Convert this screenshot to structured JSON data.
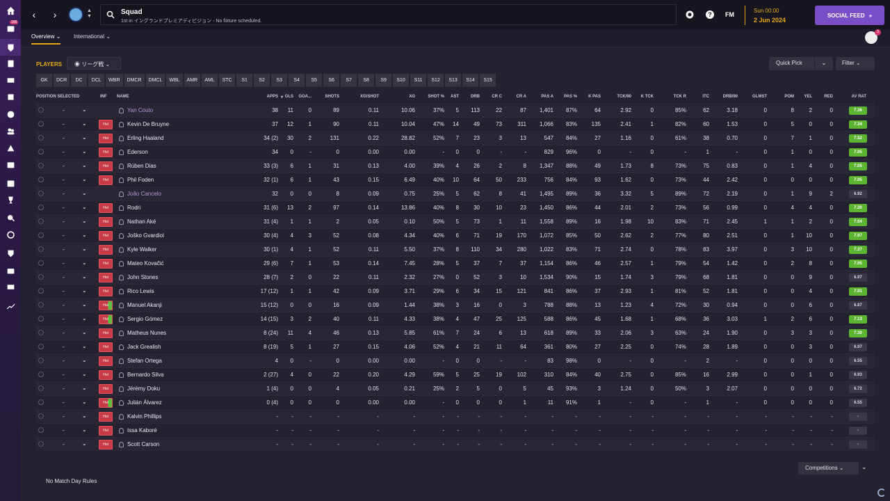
{
  "topbar": {
    "title": "Squad",
    "subtitle": "1st in イングランドプレミアディビジョン - No fixture scheduled.",
    "fm_logo": "FM",
    "date_time": "Sun 00:00",
    "date_day": "2 Jun 2024",
    "social_feed": "SOCIAL FEED",
    "rail_badge": "160",
    "avatar_badge": "3"
  },
  "subnav": {
    "tabs": [
      "Overview",
      "International"
    ]
  },
  "controls": {
    "players_label": "PLAYERS",
    "league_select": "リーグ戦",
    "quick_pick": "Quick Pick",
    "filter": "Filter",
    "competitions": "Competitions",
    "rules": "No Match Day Rules"
  },
  "positions": [
    "GK",
    "DCR",
    "DC",
    "DCL",
    "WBR",
    "DMCR",
    "DMCL",
    "WBL",
    "AMR",
    "AML",
    "STC",
    "S1",
    "S2",
    "S3",
    "S4",
    "S5",
    "S6",
    "S7",
    "S8",
    "S9",
    "S10",
    "S11",
    "S12",
    "S13",
    "S14",
    "S15"
  ],
  "columns": [
    "POSITION SELECTED",
    "INF",
    "NAME",
    "APPS",
    "GLS",
    "GOA...",
    "SHOTS",
    "XG/SHOT",
    "XG",
    "SHOT %",
    "AST",
    "DRB",
    "CR C",
    "CR A",
    "PAS A",
    "PAS %",
    "K PAS",
    "TCK/90",
    "K TCK",
    "TCK R",
    "ITC",
    "DRB/90",
    "GLMST",
    "POM",
    "YEL",
    "RED",
    "AV RAT"
  ],
  "players": [
    {
      "pos": "-",
      "inf": "",
      "name": "Yan Couto",
      "loan": true,
      "stats": [
        "38",
        "11",
        "0",
        "89",
        "0.11",
        "10.06",
        "37%",
        "5",
        "113",
        "22",
        "87",
        "1,401",
        "87%",
        "64",
        "2.92",
        "0",
        "85%",
        "62",
        "3.18",
        "0",
        "8",
        "2",
        "0"
      ],
      "rating": "7.36",
      "rc": "green"
    },
    {
      "pos": "-",
      "inf": "Hol",
      "name": "Kevin De Bruyne",
      "stats": [
        "37",
        "12",
        "1",
        "90",
        "0.11",
        "10.04",
        "47%",
        "14",
        "49",
        "73",
        "311",
        "1,066",
        "83%",
        "135",
        "2.41",
        "1",
        "82%",
        "60",
        "1.53",
        "0",
        "5",
        "0",
        "0"
      ],
      "rating": "7.34",
      "rc": "green"
    },
    {
      "pos": "-",
      "inf": "Hol",
      "name": "Erling Haaland",
      "stats": [
        "34 (2)",
        "30",
        "2",
        "131",
        "0.22",
        "28.82",
        "52%",
        "7",
        "23",
        "3",
        "13",
        "547",
        "84%",
        "27",
        "1.16",
        "0",
        "61%",
        "38",
        "0.70",
        "0",
        "7",
        "1",
        "0"
      ],
      "rating": "7.52",
      "rc": "green"
    },
    {
      "pos": "-",
      "inf": "Hol",
      "name": "Ederson",
      "stats": [
        "34",
        "0",
        "-",
        "0",
        "0.00",
        "0.00",
        "-",
        "0",
        "0",
        "-",
        "-",
        "829",
        "96%",
        "0",
        "-",
        "0",
        "-",
        "1",
        "-",
        "0",
        "1",
        "0",
        "0"
      ],
      "rating": "7.05",
      "rc": "green"
    },
    {
      "pos": "-",
      "inf": "Hol",
      "name": "Rúben Dias",
      "stats": [
        "33 (3)",
        "6",
        "1",
        "31",
        "0.13",
        "4.00",
        "39%",
        "4",
        "26",
        "2",
        "8",
        "1,347",
        "88%",
        "49",
        "1.73",
        "8",
        "73%",
        "75",
        "0.83",
        "0",
        "1",
        "4",
        "0"
      ],
      "rating": "7.05",
      "rc": "green"
    },
    {
      "pos": "-",
      "inf": "Hol",
      "name": "Phil Foden",
      "stats": [
        "32 (1)",
        "6",
        "1",
        "43",
        "0.15",
        "6.49",
        "40%",
        "10",
        "64",
        "50",
        "233",
        "756",
        "84%",
        "93",
        "1.62",
        "0",
        "73%",
        "44",
        "2.42",
        "0",
        "0",
        "0",
        "0"
      ],
      "rating": "7.05",
      "rc": "green"
    },
    {
      "pos": "-",
      "inf": "",
      "name": "João Cancelo",
      "loan": true,
      "stats": [
        "32",
        "0",
        "0",
        "8",
        "0.09",
        "0.75",
        "25%",
        "5",
        "62",
        "8",
        "41",
        "1,495",
        "89%",
        "36",
        "3.32",
        "5",
        "89%",
        "72",
        "2.19",
        "0",
        "1",
        "9",
        "2"
      ],
      "rating": "6.92",
      "rc": "dark"
    },
    {
      "pos": "-",
      "inf": "Hol",
      "name": "Rodri",
      "stats": [
        "31 (6)",
        "13",
        "2",
        "97",
        "0.14",
        "13.86",
        "40%",
        "8",
        "30",
        "10",
        "23",
        "1,450",
        "86%",
        "44",
        "2.01",
        "2",
        "73%",
        "56",
        "0.99",
        "0",
        "4",
        "4",
        "0"
      ],
      "rating": "7.20",
      "rc": "green"
    },
    {
      "pos": "-",
      "inf": "Hol",
      "name": "Nathan Aké",
      "stats": [
        "31 (4)",
        "1",
        "1",
        "2",
        "0.05",
        "0.10",
        "50%",
        "5",
        "73",
        "1",
        "11",
        "1,558",
        "89%",
        "16",
        "1.98",
        "10",
        "83%",
        "71",
        "2.45",
        "1",
        "1",
        "2",
        "0"
      ],
      "rating": "7.04",
      "rc": "green"
    },
    {
      "pos": "-",
      "inf": "Hol",
      "name": "Joško Gvardiol",
      "stats": [
        "30 (4)",
        "4",
        "3",
        "52",
        "0.08",
        "4.34",
        "40%",
        "6",
        "71",
        "19",
        "170",
        "1,072",
        "85%",
        "50",
        "2.62",
        "2",
        "77%",
        "80",
        "2.51",
        "0",
        "1",
        "10",
        "0"
      ],
      "rating": "7.07",
      "rc": "green"
    },
    {
      "pos": "-",
      "inf": "Hol",
      "name": "Kyle Walker",
      "stats": [
        "30 (1)",
        "4",
        "1",
        "52",
        "0.11",
        "5.50",
        "37%",
        "8",
        "110",
        "34",
        "280",
        "1,022",
        "83%",
        "71",
        "2.74",
        "0",
        "78%",
        "83",
        "3.97",
        "0",
        "3",
        "10",
        "0"
      ],
      "rating": "7.37",
      "rc": "green"
    },
    {
      "pos": "-",
      "inf": "Hol",
      "name": "Mateo Kovačić",
      "stats": [
        "29 (6)",
        "7",
        "1",
        "53",
        "0.14",
        "7.45",
        "28%",
        "5",
        "37",
        "7",
        "37",
        "1,154",
        "86%",
        "46",
        "2.57",
        "1",
        "79%",
        "54",
        "1.42",
        "0",
        "2",
        "8",
        "0"
      ],
      "rating": "7.05",
      "rc": "green"
    },
    {
      "pos": "-",
      "inf": "Hol",
      "name": "John Stones",
      "stats": [
        "28 (7)",
        "2",
        "0",
        "22",
        "0.11",
        "2.32",
        "27%",
        "0",
        "52",
        "3",
        "10",
        "1,534",
        "90%",
        "15",
        "1.74",
        "3",
        "79%",
        "68",
        "1.81",
        "0",
        "0",
        "9",
        "0"
      ],
      "rating": "6.97",
      "rc": "dark"
    },
    {
      "pos": "-",
      "inf": "Hol",
      "name": "Rico Lewis",
      "stats": [
        "17 (12)",
        "1",
        "1",
        "42",
        "0.09",
        "3.71",
        "29%",
        "6",
        "34",
        "15",
        "121",
        "841",
        "86%",
        "37",
        "2.93",
        "1",
        "81%",
        "52",
        "1.81",
        "0",
        "0",
        "4",
        "0"
      ],
      "rating": "7.01",
      "rc": "green"
    },
    {
      "pos": "-",
      "inf": "Hol",
      "name": "Manuel Akanji",
      "stats": [
        "15 (12)",
        "0",
        "0",
        "16",
        "0.09",
        "1.44",
        "38%",
        "3",
        "16",
        "0",
        "3",
        "788",
        "88%",
        "13",
        "1.23",
        "4",
        "72%",
        "30",
        "0.94",
        "0",
        "0",
        "6",
        "0"
      ],
      "rating": "6.87",
      "rc": "dark",
      "green": true
    },
    {
      "pos": "-",
      "inf": "Hol",
      "name": "Sergio Gómez",
      "stats": [
        "14 (15)",
        "3",
        "2",
        "40",
        "0.11",
        "4.33",
        "38%",
        "4",
        "47",
        "25",
        "125",
        "588",
        "86%",
        "45",
        "1.68",
        "1",
        "68%",
        "36",
        "3.03",
        "1",
        "2",
        "6",
        "0"
      ],
      "rating": "7.13",
      "rc": "green",
      "green": true
    },
    {
      "pos": "-",
      "inf": "Hol",
      "name": "Matheus Nunes",
      "stats": [
        "8 (24)",
        "11",
        "4",
        "46",
        "0.13",
        "5.85",
        "61%",
        "7",
        "24",
        "6",
        "13",
        "618",
        "89%",
        "33",
        "2.06",
        "3",
        "63%",
        "24",
        "1.90",
        "0",
        "3",
        "3",
        "0"
      ],
      "rating": "7.30",
      "rc": "green"
    },
    {
      "pos": "-",
      "inf": "Hol",
      "name": "Jack Grealish",
      "stats": [
        "8 (19)",
        "5",
        "1",
        "27",
        "0.15",
        "4.06",
        "52%",
        "4",
        "21",
        "11",
        "64",
        "361",
        "80%",
        "27",
        "2.25",
        "0",
        "74%",
        "28",
        "1.89",
        "0",
        "0",
        "3",
        "0"
      ],
      "rating": "6.97",
      "rc": "dark"
    },
    {
      "pos": "-",
      "inf": "Hol",
      "name": "Stefan Ortega",
      "stats": [
        "4",
        "0",
        "-",
        "0",
        "0.00",
        "0.00",
        "-",
        "0",
        "0",
        "-",
        "-",
        "83",
        "98%",
        "0",
        "-",
        "0",
        "-",
        "2",
        "-",
        "0",
        "0",
        "0",
        "0"
      ],
      "rating": "6.55",
      "rc": "dark"
    },
    {
      "pos": "-",
      "inf": "Hol",
      "name": "Bernardo Silva",
      "stats": [
        "2 (27)",
        "4",
        "0",
        "22",
        "0.20",
        "4.29",
        "59%",
        "5",
        "25",
        "19",
        "102",
        "310",
        "84%",
        "40",
        "2.75",
        "0",
        "85%",
        "16",
        "2.99",
        "0",
        "0",
        "1",
        "0"
      ],
      "rating": "6.93",
      "rc": "dark"
    },
    {
      "pos": "-",
      "inf": "Hol",
      "name": "Jérémy Doku",
      "stats": [
        "1 (4)",
        "0",
        "0",
        "4",
        "0.05",
        "0.21",
        "25%",
        "2",
        "5",
        "0",
        "5",
        "45",
        "93%",
        "3",
        "1.24",
        "0",
        "50%",
        "3",
        "2.07",
        "0",
        "0",
        "0",
        "0"
      ],
      "rating": "6.72",
      "rc": "dark"
    },
    {
      "pos": "-",
      "inf": "Hol",
      "name": "Julián Álvarez",
      "stats": [
        "0 (4)",
        "0",
        "0",
        "0",
        "0.00",
        "0.00",
        "-",
        "0",
        "0",
        "0",
        "1",
        "11",
        "91%",
        "1",
        "-",
        "0",
        "-",
        "1",
        "-",
        "0",
        "0",
        "0",
        "0"
      ],
      "rating": "6.55",
      "rc": "dark",
      "green": true
    },
    {
      "pos": "-",
      "inf": "Hol",
      "name": "Kalvin Phillips",
      "stats": [
        "-",
        "-",
        "-",
        "-",
        "-",
        "-",
        "-",
        "-",
        "-",
        "-",
        "-",
        "-",
        "-",
        "-",
        "-",
        "-",
        "-",
        "-",
        "-",
        "-",
        "-",
        "-",
        "-"
      ],
      "rating": "-",
      "rc": "dark"
    },
    {
      "pos": "-",
      "inf": "Hol",
      "name": "Issa Kaboré",
      "stats": [
        "-",
        "-",
        "-",
        "-",
        "-",
        "-",
        "-",
        "-",
        "-",
        "-",
        "-",
        "-",
        "-",
        "-",
        "-",
        "-",
        "-",
        "-",
        "-",
        "-",
        "-",
        "-",
        "-"
      ],
      "rating": "-",
      "rc": "dark"
    },
    {
      "pos": "-",
      "inf": "Hol",
      "name": "Scott Carson",
      "stats": [
        "-",
        "-",
        "-",
        "-",
        "-",
        "-",
        "-",
        "-",
        "-",
        "-",
        "-",
        "-",
        "-",
        "-",
        "-",
        "-",
        "-",
        "-",
        "-",
        "-",
        "-",
        "-",
        "-"
      ],
      "rating": "-",
      "rc": "dark"
    }
  ]
}
